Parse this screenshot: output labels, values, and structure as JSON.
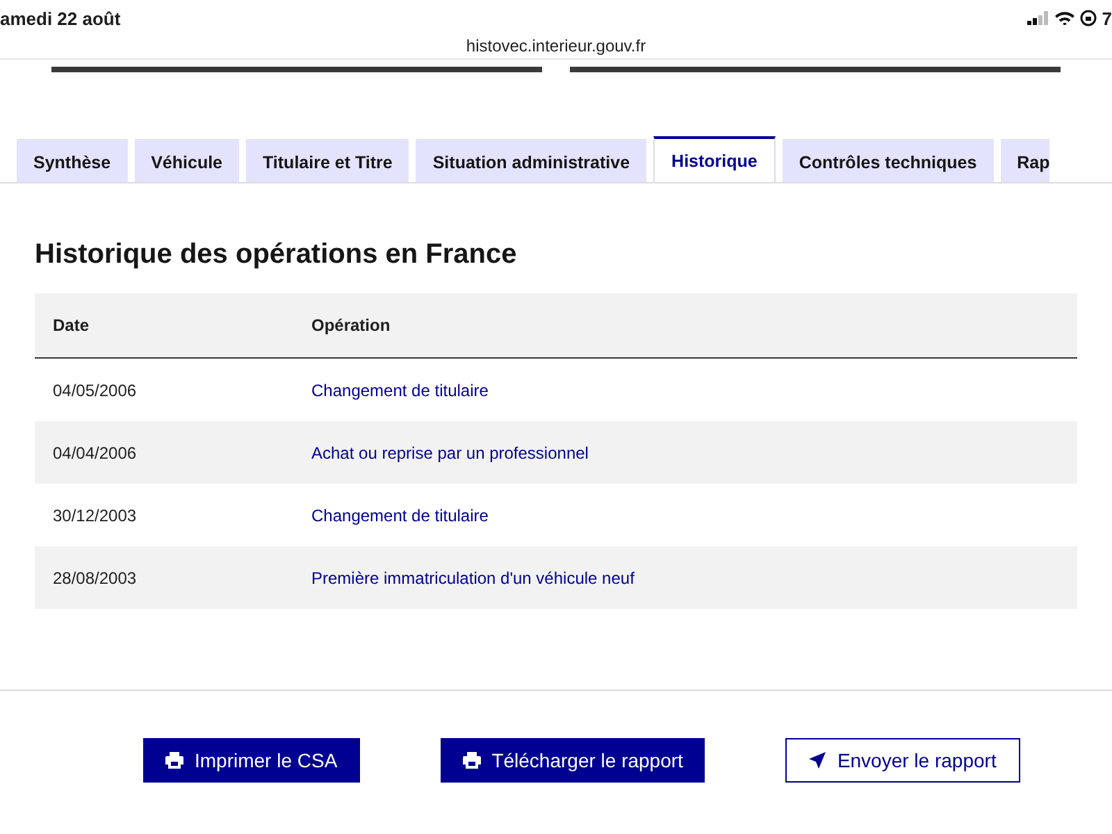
{
  "status_bar": {
    "date": "amedi 22 août",
    "battery": "7"
  },
  "address_bar": {
    "url": "histovec.interieur.gouv.fr"
  },
  "tabs": [
    {
      "label": "Synthèse",
      "selected": false
    },
    {
      "label": "Véhicule",
      "selected": false
    },
    {
      "label": "Titulaire et Titre",
      "selected": false
    },
    {
      "label": "Situation administrative",
      "selected": false
    },
    {
      "label": "Historique",
      "selected": true
    },
    {
      "label": "Contrôles techniques",
      "selected": false
    },
    {
      "label": "Rap",
      "selected": false
    }
  ],
  "panel": {
    "title": "Historique des opérations en France",
    "table": {
      "columns": [
        "Date",
        "Opération"
      ],
      "rows": [
        {
          "date": "04/05/2006",
          "operation": "Changement de titulaire"
        },
        {
          "date": "04/04/2006",
          "operation": "Achat ou reprise par un professionnel"
        },
        {
          "date": "30/12/2003",
          "operation": "Changement de titulaire"
        },
        {
          "date": "28/08/2003",
          "operation": "Première immatriculation d'un véhicule neuf"
        }
      ]
    }
  },
  "buttons": [
    {
      "label": "Imprimer le CSA",
      "kind": "primary"
    },
    {
      "label": "Télécharger le rapport",
      "kind": "primary"
    },
    {
      "label": "Envoyer le rapport",
      "kind": "secondary"
    }
  ]
}
